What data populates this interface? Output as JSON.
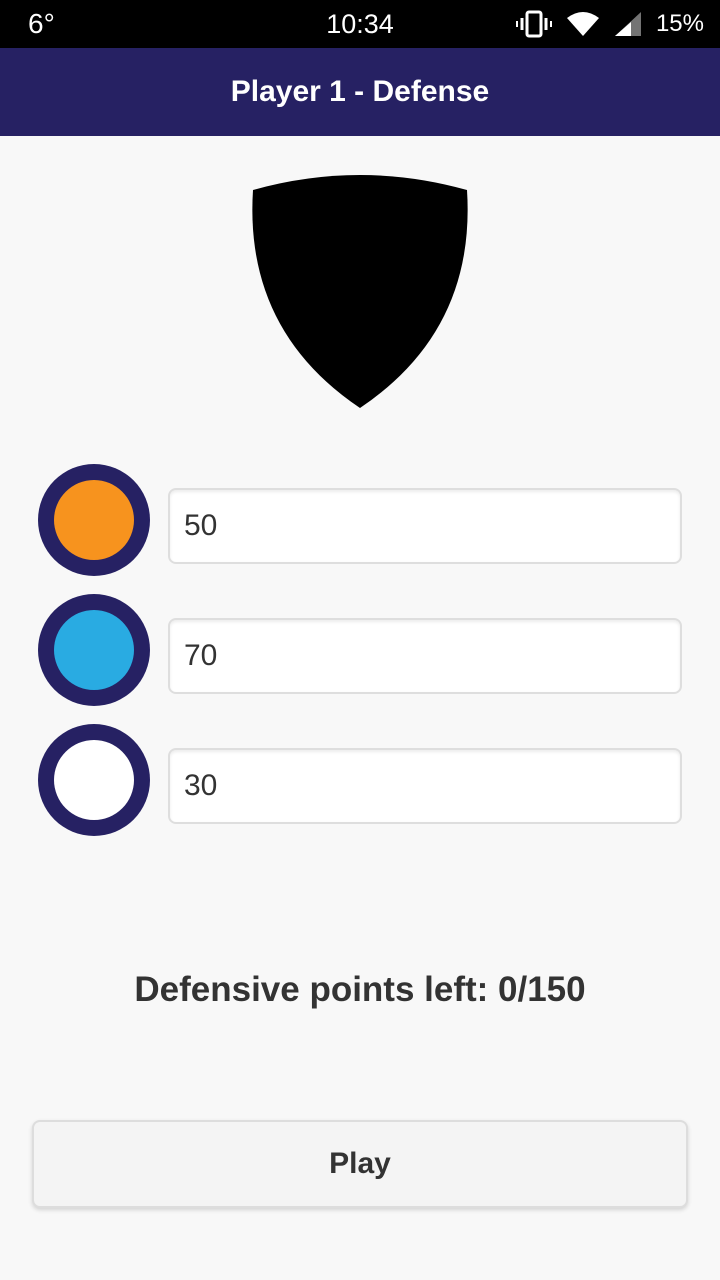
{
  "status_bar": {
    "temperature": "6°",
    "time": "10:34",
    "battery": "15%",
    "icons": [
      "vibrate-icon",
      "wifi-icon",
      "signal-icon"
    ]
  },
  "app_bar": {
    "title": "Player 1 - Defense"
  },
  "shield": {
    "icon": "shield-icon",
    "color": "#000000"
  },
  "defense_rows": [
    {
      "color_name": "orange",
      "color": "#f7931e",
      "value": "50"
    },
    {
      "color_name": "blue",
      "color": "#29abe2",
      "value": "70"
    },
    {
      "color_name": "white",
      "color": "#ffffff",
      "value": "30"
    }
  ],
  "points_left": "Defensive points left: 0/150",
  "play_button": {
    "label": "Play"
  },
  "colors": {
    "primary": "#262163",
    "background": "#f8f8f8"
  }
}
